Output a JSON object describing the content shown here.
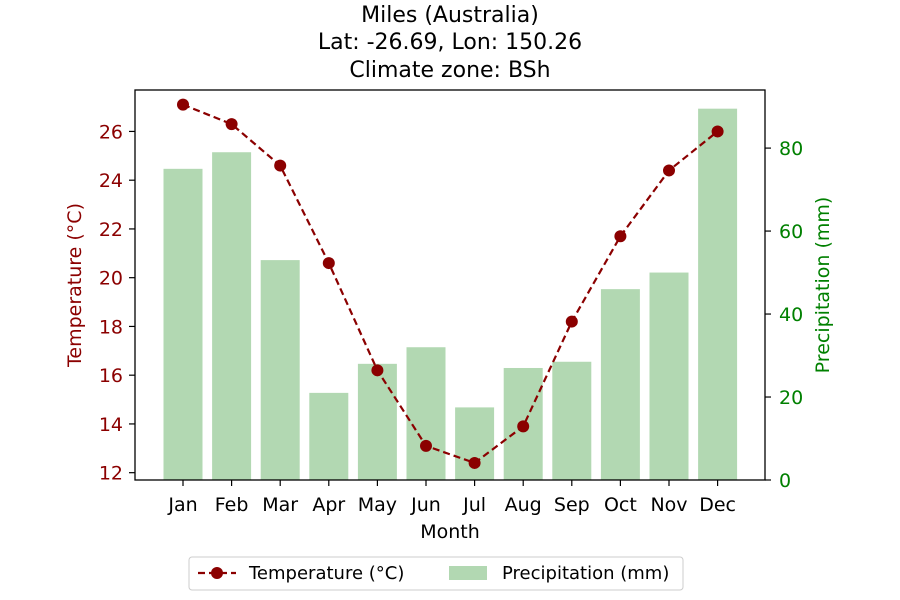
{
  "chart_data": {
    "type": "bar",
    "title": [
      "Miles (Australia)",
      "Lat: -26.69, Lon: 150.26",
      "Climate zone: BSh"
    ],
    "categories": [
      "Jan",
      "Feb",
      "Mar",
      "Apr",
      "May",
      "Jun",
      "Jul",
      "Aug",
      "Sep",
      "Oct",
      "Nov",
      "Dec"
    ],
    "xlabel": "Month",
    "series": [
      {
        "name": "Temperature (°C)",
        "type": "line",
        "axis": "left",
        "color": "#8b0000",
        "values": [
          27.1,
          26.3,
          24.6,
          20.6,
          16.2,
          13.1,
          12.4,
          13.9,
          18.2,
          21.7,
          24.4,
          26.0
        ]
      },
      {
        "name": "Precipitation (mm)",
        "type": "bar",
        "axis": "right",
        "color": "#b2d8b2",
        "values": [
          75,
          79,
          53,
          21,
          28,
          32,
          17.5,
          27,
          28.5,
          46,
          50,
          89.5
        ]
      }
    ],
    "y_left": {
      "label": "Temperature (°C)",
      "color": "#8b0000",
      "ylim": [
        11.7,
        27.7
      ],
      "ticks": [
        12,
        14,
        16,
        18,
        20,
        22,
        24,
        26
      ]
    },
    "y_right": {
      "label": "Precipitation (mm)",
      "color": "#008000",
      "ylim": [
        0,
        94
      ],
      "ticks": [
        0,
        20,
        40,
        60,
        80
      ]
    },
    "legend_position": "bottom-center",
    "grid": false
  }
}
